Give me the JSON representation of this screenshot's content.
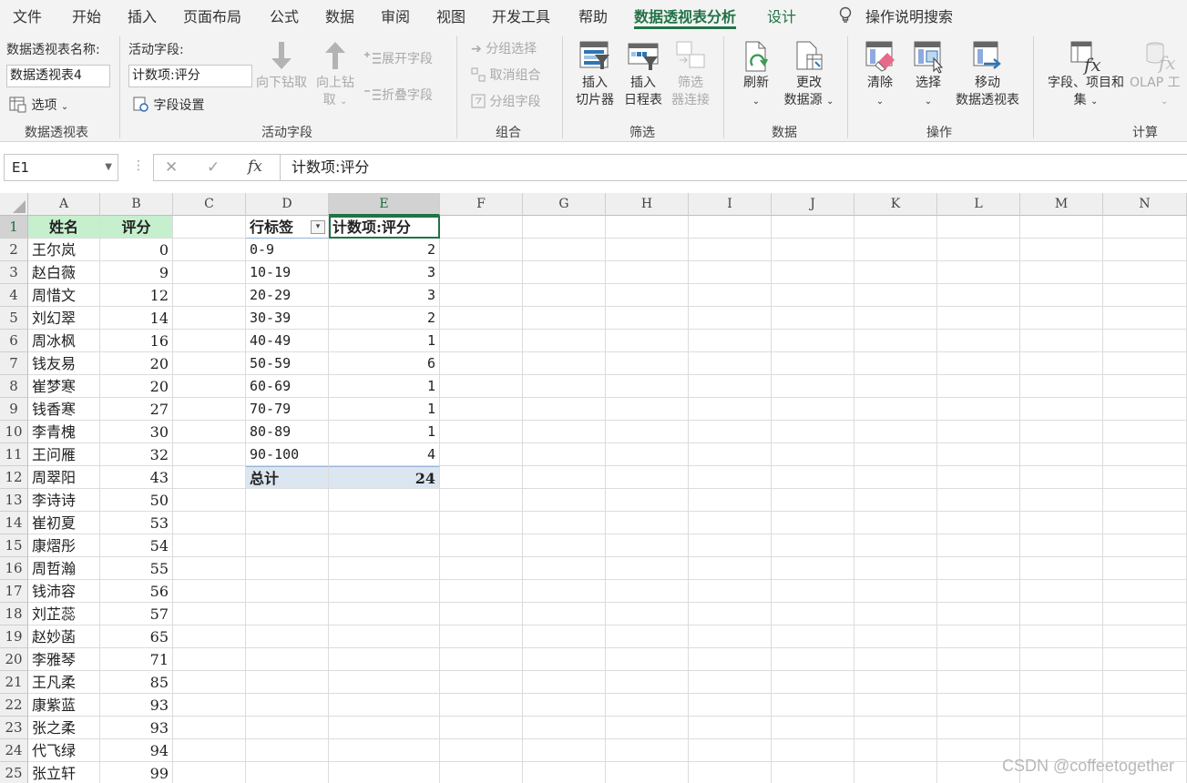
{
  "ribbon_tabs": [
    "文件",
    "开始",
    "插入",
    "页面布局",
    "公式",
    "数据",
    "审阅",
    "视图",
    "开发工具",
    "帮助",
    "数据透视表分析",
    "设计"
  ],
  "tell_me": "操作说明搜索",
  "pivot_group": {
    "name_label": "数据透视表名称:",
    "name_value": "数据透视表4",
    "options_btn": "选项",
    "label": "数据透视表"
  },
  "active_field_group": {
    "label_caption": "活动字段:",
    "field_value": "计数项:评分",
    "field_settings": "字段设置",
    "drill_down": "向下钻取",
    "drill_up_1": "向上钻",
    "drill_up_2": "取",
    "expand": "展开字段",
    "collapse": "折叠字段",
    "label": "活动字段"
  },
  "group_group": {
    "group_selection": "分组选择",
    "ungroup": "取消组合",
    "group_field": "分组字段",
    "label": "组合"
  },
  "filter_group": {
    "slicer_1": "插入",
    "slicer_2": "切片器",
    "timeline_1": "插入",
    "timeline_2": "日程表",
    "filter_conn_1": "筛选",
    "filter_conn_2": "器连接",
    "label": "筛选"
  },
  "data_group": {
    "refresh": "刷新",
    "change_source_1": "更改",
    "change_source_2": "数据源",
    "label": "数据"
  },
  "actions_group": {
    "clear": "清除",
    "select": "选择",
    "move_1": "移动",
    "move_2": "数据透视表",
    "label": "操作"
  },
  "calc_group": {
    "fields_1": "字段、项目和",
    "fields_2": "集",
    "olap": "OLAP 工",
    "label": "计算"
  },
  "formula_bar": {
    "name_box": "E1",
    "cancel": "✕",
    "enter": "✓",
    "fx": "fx",
    "formula": "计数项:评分"
  },
  "columns": [
    "A",
    "B",
    "C",
    "D",
    "E",
    "F",
    "G",
    "H",
    "I",
    "J",
    "K",
    "L",
    "M",
    "N"
  ],
  "rows": [
    "1",
    "2",
    "3",
    "4",
    "5",
    "6",
    "7",
    "8",
    "9",
    "10",
    "11",
    "12",
    "13",
    "14",
    "15",
    "16",
    "17",
    "18",
    "19",
    "20",
    "21",
    "22",
    "23",
    "24",
    "25"
  ],
  "source_table": {
    "headers": [
      "姓名",
      "评分"
    ],
    "rows": [
      [
        "王尔岚",
        "0"
      ],
      [
        "赵白薇",
        "9"
      ],
      [
        "周惜文",
        "12"
      ],
      [
        "刘幻翠",
        "14"
      ],
      [
        "周冰枫",
        "16"
      ],
      [
        "钱友易",
        "20"
      ],
      [
        "崔梦寒",
        "20"
      ],
      [
        "钱香寒",
        "27"
      ],
      [
        "李青槐",
        "30"
      ],
      [
        "王问雁",
        "32"
      ],
      [
        "周翠阳",
        "43"
      ],
      [
        "李诗诗",
        "50"
      ],
      [
        "崔初夏",
        "53"
      ],
      [
        "康熠彤",
        "54"
      ],
      [
        "周哲瀚",
        "55"
      ],
      [
        "钱沛容",
        "56"
      ],
      [
        "刘芷蕊",
        "57"
      ],
      [
        "赵妙菡",
        "65"
      ],
      [
        "李雅琴",
        "71"
      ],
      [
        "王凡柔",
        "85"
      ],
      [
        "康紫蓝",
        "93"
      ],
      [
        "张之柔",
        "93"
      ],
      [
        "代飞绿",
        "94"
      ],
      [
        "张立轩",
        "99"
      ]
    ]
  },
  "pivot_table": {
    "row_label_header": "行标签",
    "value_header": "计数项:评分",
    "rows": [
      [
        "0-9",
        "2"
      ],
      [
        "10-19",
        "3"
      ],
      [
        "20-29",
        "3"
      ],
      [
        "30-39",
        "2"
      ],
      [
        "40-49",
        "1"
      ],
      [
        "50-59",
        "6"
      ],
      [
        "60-69",
        "1"
      ],
      [
        "70-79",
        "1"
      ],
      [
        "80-89",
        "1"
      ],
      [
        "90-100",
        "4"
      ]
    ],
    "total_label": "总计",
    "total_value": "24"
  },
  "watermark": "CSDN @coffeetogether"
}
